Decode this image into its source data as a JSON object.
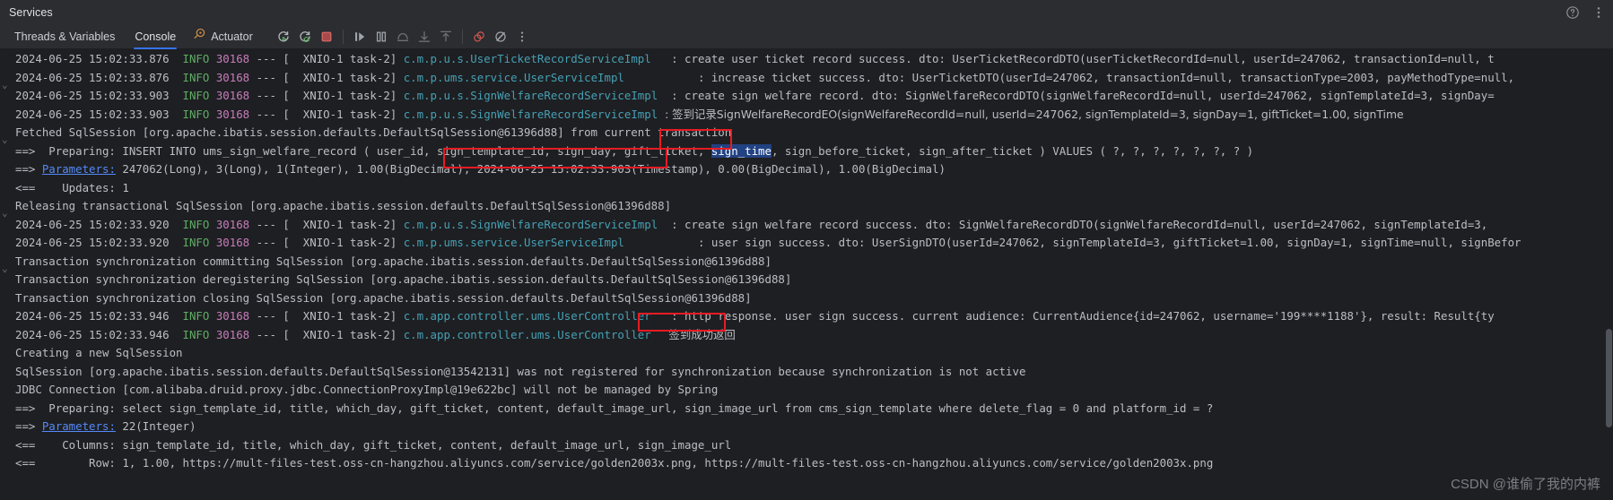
{
  "window": {
    "title": "Services",
    "icons": [
      "help-icon",
      "more-options-icon"
    ]
  },
  "toolbar": {
    "tabs": [
      {
        "label": "Threads & Variables",
        "active": false
      },
      {
        "label": "Console",
        "active": true
      },
      {
        "label": "Actuator",
        "active": false,
        "icon": "actuator-icon"
      }
    ],
    "buttons": [
      {
        "name": "rerun-icon",
        "title": "Rerun"
      },
      {
        "name": "rerun-debug-icon",
        "title": "Rerun with Debug"
      },
      {
        "name": "stop-icon",
        "title": "Stop"
      },
      {
        "name": "resume-program-icon",
        "title": "Resume Program"
      },
      {
        "name": "pause-program-icon",
        "title": "Pause Program"
      },
      {
        "name": "step-over-icon",
        "title": "Step Over"
      },
      {
        "name": "step-into-icon",
        "title": "Step Into"
      },
      {
        "name": "step-out-icon",
        "title": "Step Out"
      },
      {
        "name": "mute-breakpoints-icon",
        "title": "Mute Breakpoints"
      },
      {
        "name": "view-breakpoints-icon",
        "title": "View Breakpoints"
      },
      {
        "name": "more-actions-icon",
        "title": "More"
      }
    ]
  },
  "console": {
    "lines": [
      {
        "type": "log",
        "time": "2024-06-25 15:02:33.876",
        "level": "INFO",
        "pid": "30168",
        "thread": "XNIO-1 task-2",
        "logger": "c.m.p.u.s.UserTicketRecordServiceImpl",
        "pad": "  ",
        "msg": ": create user ticket record success. dto: UserTicketRecordDTO(userTicketRecordId=null, userId=247062, transactionId=null, t"
      },
      {
        "type": "log",
        "time": "2024-06-25 15:02:33.876",
        "level": "INFO",
        "pid": "30168",
        "thread": "XNIO-1 task-2",
        "logger": "c.m.p.ums.service.UserServiceImpl",
        "pad": "          ",
        "msg": ": increase ticket success. dto: UserTicketDTO(userId=247062, transactionId=null, transactionType=2003, payMethodType=null,"
      },
      {
        "type": "log",
        "time": "2024-06-25 15:02:33.903",
        "level": "INFO",
        "pid": "30168",
        "thread": "XNIO-1 task-2",
        "logger": "c.m.p.u.s.SignWelfareRecordServiceImpl",
        "pad": " ",
        "msg": ": create sign welfare record. dto: SignWelfareRecordDTO(signWelfareRecordId=null, userId=247062, signTemplateId=3, signDay="
      },
      {
        "type": "log",
        "time": "2024-06-25 15:02:33.903",
        "level": "INFO",
        "pid": "30168",
        "thread": "XNIO-1 task-2",
        "logger": "c.m.p.u.s.SignWelfareRecordServiceImpl",
        "pad": " ",
        "msg": ": 签到记录SignWelfareRecordEO(signWelfareRecordId=null, userId=247062, signTemplateId=3, signDay=1, giftTicket=1.00, signTime"
      },
      {
        "type": "plain",
        "text": "Fetched SqlSession [org.apache.ibatis.session.defaults.DefaultSqlSession@61396d88] from current transaction"
      },
      {
        "type": "sql-prepare",
        "prefix": "==>  Preparing: ",
        "before": "INSERT INTO ums_sign_welfare_record ( user_id, sign_template_id, sign_day, gift_ticket, ",
        "selected": "sign_time",
        "after": ", sign_before_ticket, sign_after_ticket ) VALUES ( ?, ?, ?, ?, ?, ?, ? )"
      },
      {
        "type": "sql-params",
        "prefix": "==> ",
        "link": "Parameters:",
        "text": " 247062(Long), 3(Long), 1(Integer), 1.00(BigDecimal), 2024-06-25 15:02:33.903(Timestamp), 0.00(BigDecimal), 1.00(BigDecimal)"
      },
      {
        "type": "plain",
        "text": "<==    Updates: 1"
      },
      {
        "type": "plain",
        "text": "Releasing transactional SqlSession [org.apache.ibatis.session.defaults.DefaultSqlSession@61396d88]"
      },
      {
        "type": "log",
        "time": "2024-06-25 15:02:33.920",
        "level": "INFO",
        "pid": "30168",
        "thread": "XNIO-1 task-2",
        "logger": "c.m.p.u.s.SignWelfareRecordServiceImpl",
        "pad": " ",
        "msg": ": create sign welfare record success. dto: SignWelfareRecordDTO(signWelfareRecordId=null, userId=247062, signTemplateId=3,"
      },
      {
        "type": "log",
        "time": "2024-06-25 15:02:33.920",
        "level": "INFO",
        "pid": "30168",
        "thread": "XNIO-1 task-2",
        "logger": "c.m.p.ums.service.UserServiceImpl",
        "pad": "          ",
        "msg": ": user sign success. dto: UserSignDTO(userId=247062, signTemplateId=3, giftTicket=1.00, signDay=1, signTime=null, signBefor"
      },
      {
        "type": "plain",
        "text": "Transaction synchronization committing SqlSession [org.apache.ibatis.session.defaults.DefaultSqlSession@61396d88]"
      },
      {
        "type": "plain",
        "text": "Transaction synchronization deregistering SqlSession [org.apache.ibatis.session.defaults.DefaultSqlSession@61396d88]"
      },
      {
        "type": "plain",
        "text": "Transaction synchronization closing SqlSession [org.apache.ibatis.session.defaults.DefaultSqlSession@61396d88]"
      },
      {
        "type": "log",
        "time": "2024-06-25 15:02:33.946",
        "level": "INFO",
        "pid": "30168",
        "thread": "XNIO-1 task-2",
        "logger": "c.m.app.controller.ums.UserController",
        "pad": "  ",
        "msg": ": http response. user sign success. current audience: CurrentAudience{id=247062, username='199****1188'}, result: Result{ty"
      },
      {
        "type": "log",
        "time": "2024-06-25 15:02:33.946",
        "level": "INFO",
        "pid": "30168",
        "thread": "XNIO-1 task-2",
        "logger": "c.m.app.controller.ums.UserController",
        "pad": "  ",
        "msg": "  签到成功返回"
      },
      {
        "type": "plain",
        "text": "Creating a new SqlSession"
      },
      {
        "type": "plain",
        "text": "SqlSession [org.apache.ibatis.session.defaults.DefaultSqlSession@13542131] was not registered for synchronization because synchronization is not active"
      },
      {
        "type": "plain",
        "text": "JDBC Connection [com.alibaba.druid.proxy.jdbc.ConnectionProxyImpl@19e622bc] will not be managed by Spring"
      },
      {
        "type": "plain",
        "text": "==>  Preparing: select sign_template_id, title, which_day, gift_ticket, content, default_image_url, sign_image_url from cms_sign_template where delete_flag = 0 and platform_id = ?"
      },
      {
        "type": "sql-params",
        "prefix": "==> ",
        "link": "Parameters:",
        "text": " 22(Integer)"
      },
      {
        "type": "plain",
        "text": "<==    Columns: sign_template_id, title, which_day, gift_ticket, content, default_image_url, sign_image_url"
      },
      {
        "type": "plain-partial",
        "text": "<==        Row: 1, 1.00, https://mult-files-test.oss-cn-hangzhou.aliyuncs.com/service/golden2003x.png, https://mult-files-test.oss-cn-hangzhou.aliyuncs.com/service/golden2003x.png"
      }
    ],
    "annotations": [
      {
        "name": "sign-time-highlight-box",
        "label": "sign_time"
      },
      {
        "name": "timestamp-param-box",
        "label": "2024-06-25 15:02:33.903(Timestamp),"
      },
      {
        "name": "sign-success-return-box",
        "label": "签到成功返回"
      }
    ]
  },
  "watermark": "CSDN @谁偷了我的内裤"
}
